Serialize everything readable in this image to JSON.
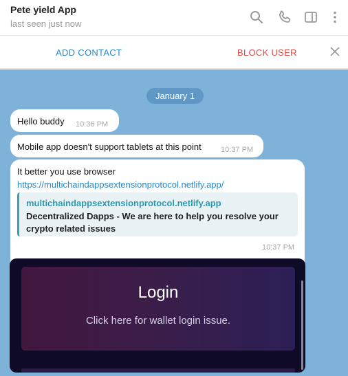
{
  "header": {
    "title": "Pete yield App",
    "status": "last seen just now",
    "icons": [
      "search-icon",
      "phone-icon",
      "sidebar-toggle-icon",
      "more-vert-icon"
    ]
  },
  "actions": {
    "add_contact": "ADD CONTACT",
    "block_user": "BLOCK USER"
  },
  "chat": {
    "date": "January 1",
    "messages": [
      {
        "text": "Hello buddy",
        "time": "10:36 PM"
      },
      {
        "text": "Mobile app doesn't support tablets at this point",
        "time": "10:37 PM"
      },
      {
        "text": "It better you use browser",
        "link": "https://multichaindappsextensionprotocol.netlify.app/",
        "preview": {
          "site": "multichaindappsextensionprotocol.netlify.app",
          "description": "Decentralized Dapps - We are here to help you resolve your crypto related issues"
        },
        "time": "10:37 PM"
      }
    ],
    "image_card": {
      "title": "Login",
      "subtitle": "Click here for wallet login issue."
    }
  },
  "colors": {
    "accent_blue": "#2a87c9",
    "block_red": "#d64b45",
    "chat_bg": "#7eb2d9",
    "date_pill": "#5f98c4"
  }
}
